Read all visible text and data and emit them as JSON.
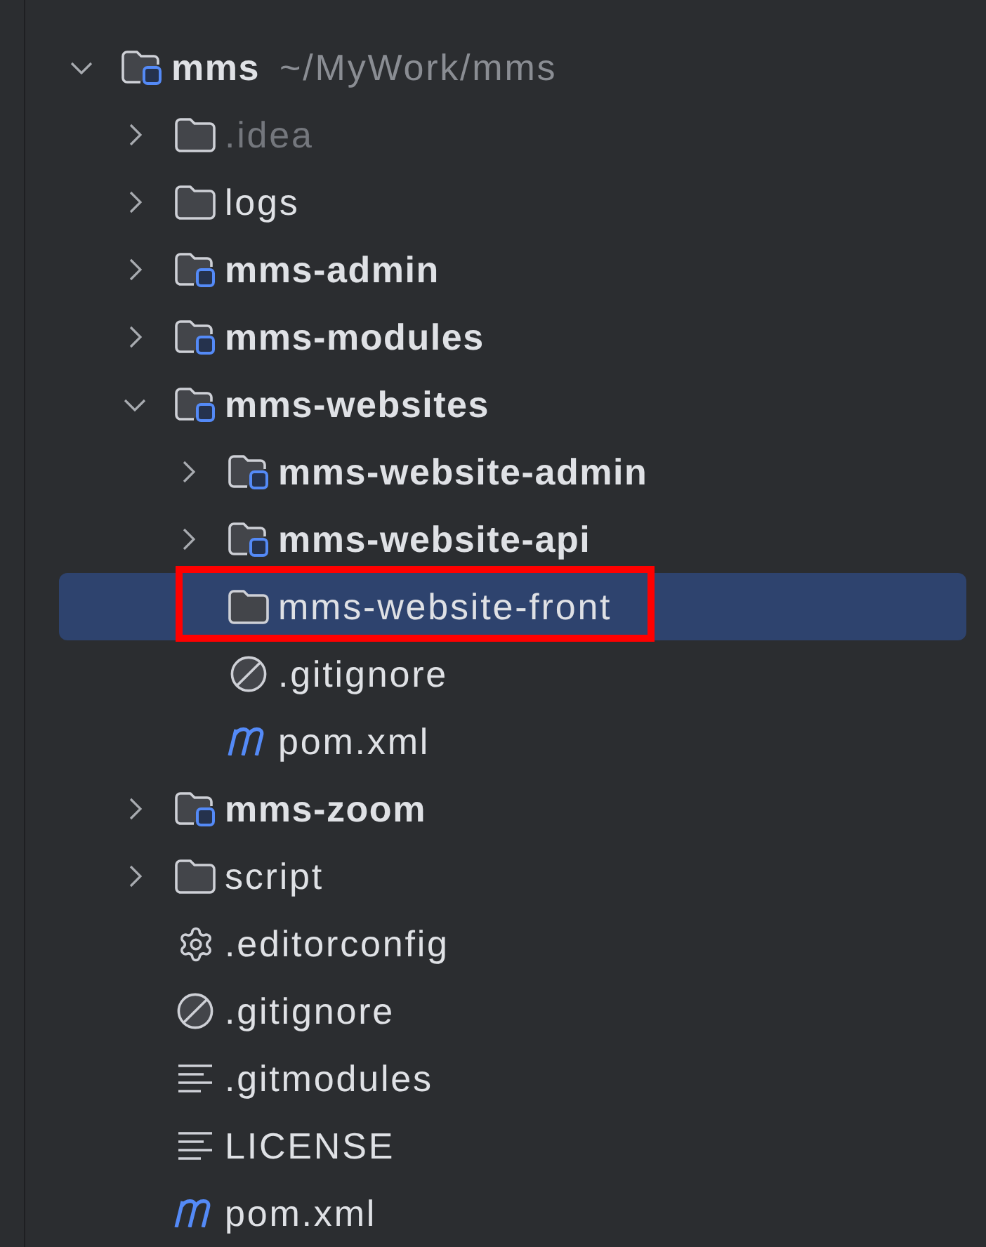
{
  "project_tree": {
    "items": [
      {
        "kind": "module",
        "label": "mms",
        "location": "~/MyWork/mms",
        "expanded": true,
        "selected": false,
        "excluded": false,
        "marked": false,
        "children": [
          {
            "kind": "folder",
            "label": ".idea",
            "expanded": false,
            "selected": false,
            "excluded": true,
            "marked": false
          },
          {
            "kind": "folder",
            "label": "logs",
            "expanded": false,
            "selected": false,
            "excluded": false,
            "marked": false
          },
          {
            "kind": "module",
            "label": "mms-admin",
            "expanded": false,
            "selected": false,
            "excluded": false,
            "marked": false
          },
          {
            "kind": "module",
            "label": "mms-modules",
            "expanded": false,
            "selected": false,
            "excluded": false,
            "marked": false
          },
          {
            "kind": "module",
            "label": "mms-websites",
            "expanded": true,
            "selected": false,
            "excluded": false,
            "marked": false,
            "children": [
              {
                "kind": "module",
                "label": "mms-website-admin",
                "expanded": false,
                "selected": false,
                "excluded": false,
                "marked": false
              },
              {
                "kind": "module",
                "label": "mms-website-api",
                "expanded": false,
                "selected": false,
                "excluded": false,
                "marked": false
              },
              {
                "kind": "folder",
                "label": "mms-website-front",
                "selected": true,
                "excluded": false,
                "marked": true
              },
              {
                "kind": "ignore",
                "label": ".gitignore",
                "selected": false,
                "excluded": false,
                "marked": false
              },
              {
                "kind": "maven",
                "label": "pom.xml",
                "selected": false,
                "excluded": false,
                "marked": false
              }
            ]
          },
          {
            "kind": "module",
            "label": "mms-zoom",
            "expanded": false,
            "selected": false,
            "excluded": false,
            "marked": false
          },
          {
            "kind": "folder",
            "label": "script",
            "expanded": false,
            "selected": false,
            "excluded": false,
            "marked": false
          },
          {
            "kind": "config",
            "label": ".editorconfig",
            "selected": false,
            "excluded": false,
            "marked": false
          },
          {
            "kind": "ignore",
            "label": ".gitignore",
            "selected": false,
            "excluded": false,
            "marked": false
          },
          {
            "kind": "text",
            "label": ".gitmodules",
            "selected": false,
            "excluded": false,
            "marked": false
          },
          {
            "kind": "text",
            "label": "LICENSE",
            "selected": false,
            "excluded": false,
            "marked": false
          },
          {
            "kind": "maven",
            "label": "pom.xml",
            "selected": false,
            "excluded": false,
            "marked": false
          }
        ]
      }
    ]
  }
}
